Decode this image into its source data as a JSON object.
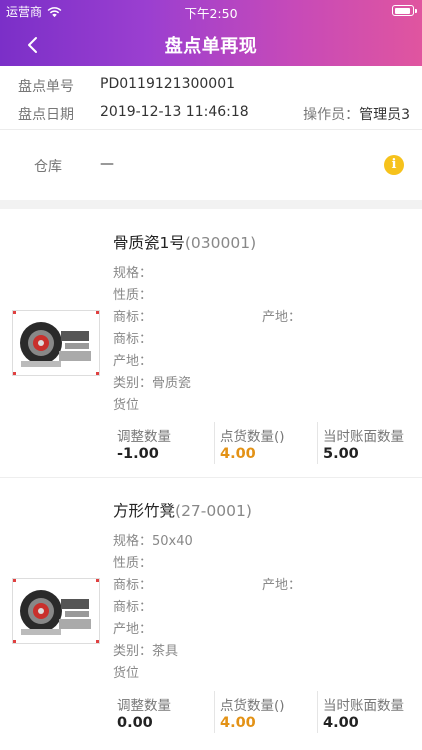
{
  "status_bar": {
    "carrier": "运营商",
    "time": "下午2:50"
  },
  "nav": {
    "title": "盘点单再现"
  },
  "info": {
    "order_no_label": "盘点单号",
    "order_no": "PD0119121300001",
    "date_label": "盘点日期",
    "date": "2019-12-13 11:46:18",
    "operator_label": "操作员：",
    "operator": "管理员3",
    "warehouse_label": "仓库",
    "warehouse": "—",
    "info_icon": "i"
  },
  "labels": {
    "spec": "规格：",
    "nature": "性质：",
    "brand": "商标：",
    "origin": "产地：",
    "category": "类别：",
    "location": "货位",
    "adjust_qty": "调整数量",
    "count_qty": "点货数量()",
    "book_qty": "当时账面数量"
  },
  "products": [
    {
      "name": "骨质瓷1号",
      "code": "(030001)",
      "spec": "",
      "category": "骨质瓷",
      "adjust_qty": "-1.00",
      "count_qty": "4.00",
      "book_qty": "5.00"
    },
    {
      "name": "方形竹凳",
      "code": "(27-0001)",
      "spec": "50x40",
      "category": "茶具",
      "adjust_qty": "0.00",
      "count_qty": "4.00",
      "book_qty": "4.00"
    }
  ],
  "colors": {
    "accent_orange": "#e39216",
    "info_yellow": "#f6c21c",
    "header_start": "#7b2fc8",
    "header_end": "#e0559f"
  }
}
